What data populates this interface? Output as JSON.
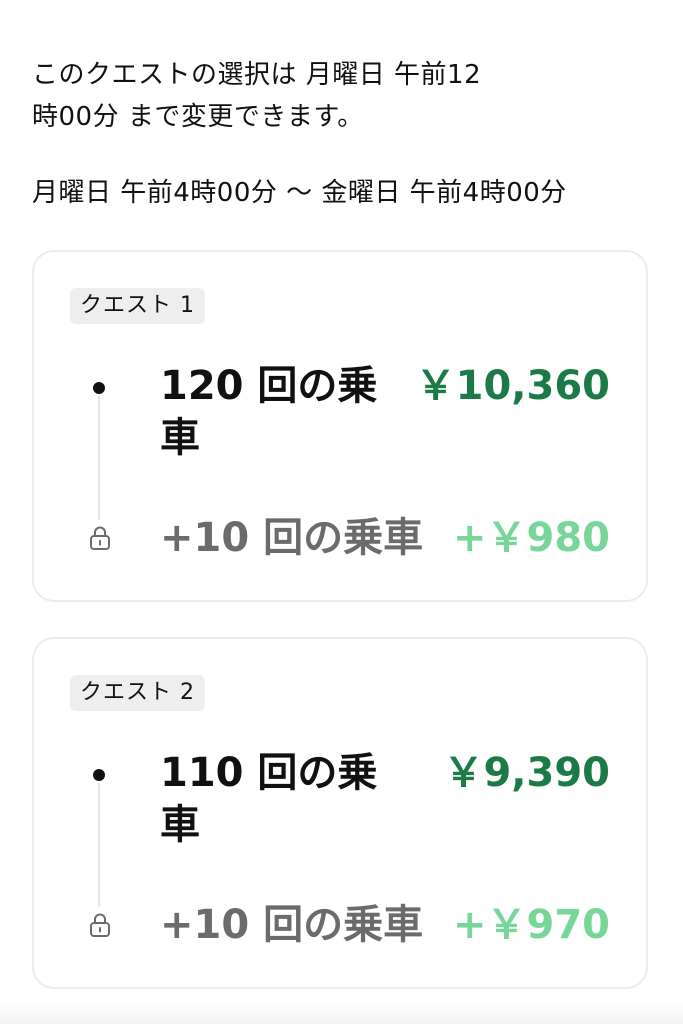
{
  "intro": {
    "text": "このクエストの選択は 月曜日 午前12時00分 まで変更できます。"
  },
  "period": {
    "text": "月曜日 午前4時00分 〜 金曜日 午前4時00分"
  },
  "quests": [
    {
      "badge": "クエスト 1",
      "rides": "120 回の乗車",
      "amount": "￥10,360",
      "bonus_rides": "+10 回の乗車",
      "bonus_amount": "+￥980"
    },
    {
      "badge": "クエスト 2",
      "rides": "110 回の乗車",
      "amount": "￥9,390",
      "bonus_rides": "+10 回の乗車",
      "bonus_amount": "+￥970"
    }
  ],
  "colors": {
    "amount": "#1b7a47",
    "bonus_amount": "#79d69a",
    "bonus_text": "#6b6b6b",
    "badge_bg": "#eeeeee",
    "card_border": "#ececec"
  },
  "icons": {
    "lock": "lock-icon",
    "bullet": "bullet-dot"
  }
}
